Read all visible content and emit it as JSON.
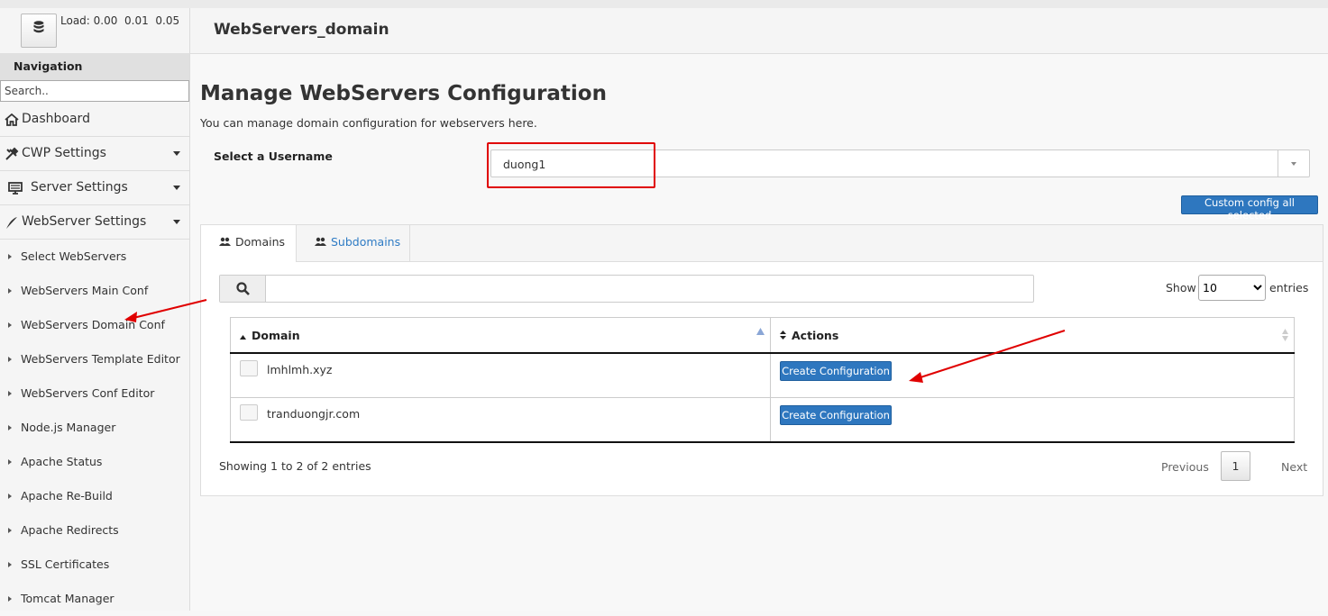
{
  "system": {
    "load_label": "Load:",
    "load_values": "0.00  0.01  0.05"
  },
  "sidebar": {
    "nav_title": "Navigation",
    "search_placeholder": "Search..",
    "menu": [
      {
        "label": "Dashboard",
        "icon": "home-icon"
      },
      {
        "label": "CWP Settings",
        "icon": "tools-icon"
      },
      {
        "label": "Server Settings",
        "icon": "server-icon"
      },
      {
        "label": "WebServer Settings",
        "icon": "feather-icon"
      }
    ],
    "submenu": [
      "Select WebServers",
      "WebServers Main Conf",
      "WebServers Domain Conf",
      "WebServers Template Editor",
      "WebServers Conf Editor",
      "Node.js Manager",
      "Apache Status",
      "Apache Re-Build",
      "Apache Redirects",
      "SSL Certificates",
      "Tomcat Manager"
    ]
  },
  "header": {
    "title": "WebServers_domain"
  },
  "main": {
    "title": "Manage WebServers Configuration",
    "description": "You can manage domain configuration for webservers here.",
    "username_label": "Select a Username",
    "username_value": "duong1",
    "custom_button": "Custom config all selected",
    "tabs": [
      {
        "label": "Domains",
        "icon": "users-icon"
      },
      {
        "label": "Subdomains",
        "icon": "users-icon"
      }
    ],
    "show_label": "Show",
    "show_value": "10",
    "entries_label": "entries",
    "table": {
      "columns": [
        "Domain",
        "Actions"
      ],
      "rows": [
        {
          "domain": "lmhlmh.xyz",
          "action": "Create Configuration"
        },
        {
          "domain": "tranduongjr.com",
          "action": "Create Configuration"
        }
      ]
    },
    "info": "Showing 1 to 2 of 2 entries",
    "pagination": {
      "previous": "Previous",
      "page": "1",
      "next": "Next"
    }
  },
  "colors": {
    "accent": "#2e77bf",
    "annotation": "#e00000",
    "link": "#2e7bc4"
  }
}
